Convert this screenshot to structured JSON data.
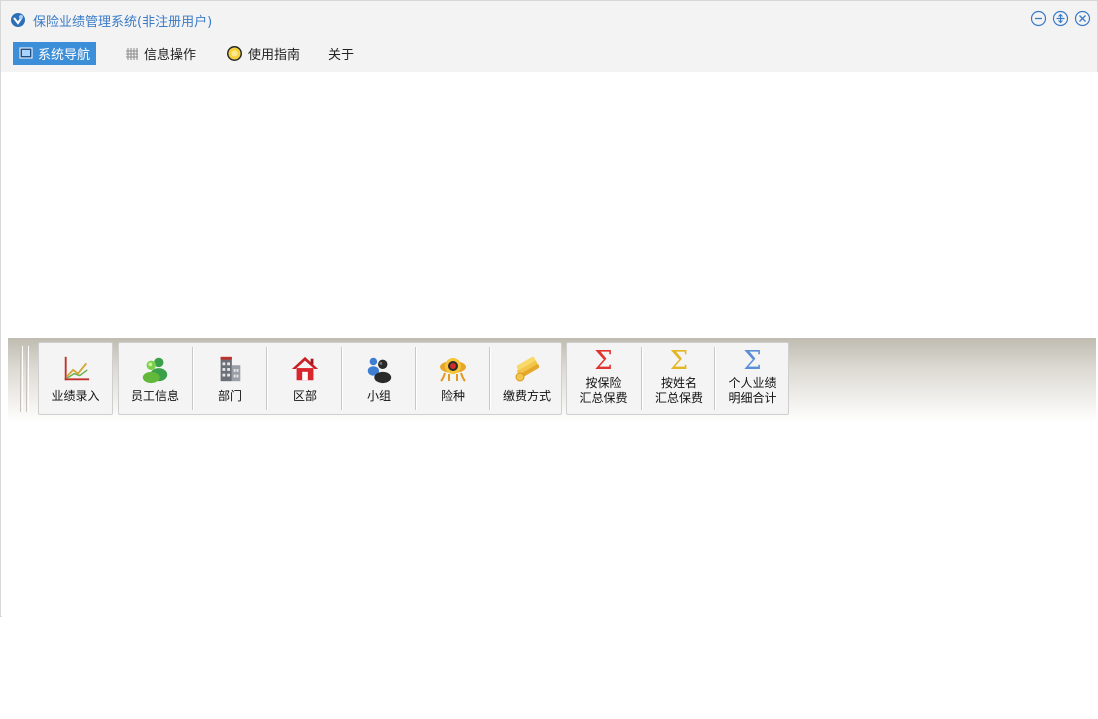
{
  "window": {
    "title": "保险业绩管理系统(非注册用户)",
    "controls": {
      "minimize": "minimize-icon",
      "restore": "restore-icon",
      "close": "close-icon"
    }
  },
  "menu": {
    "items": [
      {
        "label": "系统导航",
        "icon": "monitor-icon",
        "active": true
      },
      {
        "label": "信息操作",
        "icon": "grid-icon",
        "active": false
      },
      {
        "label": "使用指南",
        "icon": "help-bulb-icon",
        "active": false
      },
      {
        "label": "关于",
        "icon": "",
        "active": false
      }
    ]
  },
  "toolbar": {
    "buttons": [
      {
        "label": "业绩录入",
        "icon": "line-chart-icon"
      },
      {
        "label": "员工信息",
        "icon": "users-icon"
      },
      {
        "label": "部门",
        "icon": "building-icon"
      },
      {
        "label": "区部",
        "icon": "home-icon"
      },
      {
        "label": "小组",
        "icon": "group-icon"
      },
      {
        "label": "险种",
        "icon": "insurance-icon"
      },
      {
        "label": "缴费方式",
        "icon": "coins-icon"
      },
      {
        "label_line1": "按保险",
        "label_line2": "汇总保费",
        "icon": "sigma-red-icon"
      },
      {
        "label_line1": "按姓名",
        "label_line2": "汇总保费",
        "icon": "sigma-yellow-icon"
      },
      {
        "label_line1": "个人业绩",
        "label_line2": "明细合计",
        "icon": "sigma-blue-icon"
      }
    ]
  },
  "colors": {
    "accent": "#3d8ed8",
    "title_text": "#3a7bc8",
    "sigma_red": "#e0322f",
    "sigma_yellow": "#e5b623",
    "sigma_blue": "#5a8fd6"
  }
}
